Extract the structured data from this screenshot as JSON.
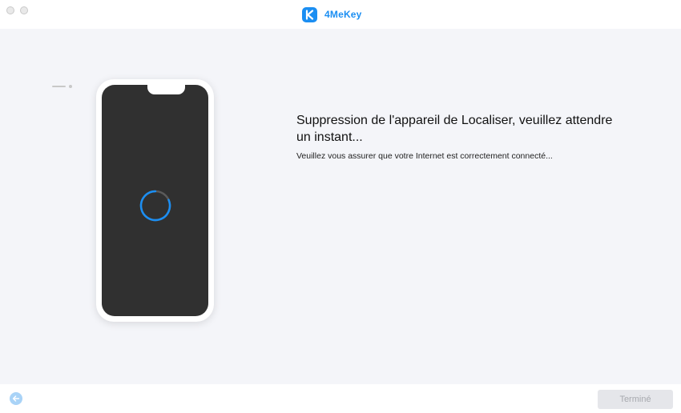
{
  "window": {
    "title": "4MeKey"
  },
  "main": {
    "heading": "Suppression de l'appareil de Localiser, veuillez attendre un instant...",
    "subtext": "Veuillez vous assurer que votre Internet est correctement connecté..."
  },
  "footer": {
    "done_label": "Terminé"
  },
  "icons": {
    "logo": "4mekey-logo-icon",
    "back": "arrow-left-icon",
    "spinner": "loading-spinner-icon"
  },
  "colors": {
    "accent": "#1b8ef2",
    "background": "#f4f5f9",
    "phone_screen": "#303030"
  }
}
